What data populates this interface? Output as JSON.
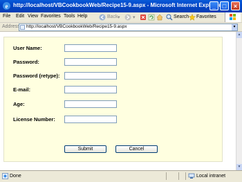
{
  "window": {
    "title": "http://localhost/VBCookbookWeb/Recipe15-9.aspx - Microsoft Internet Explorer"
  },
  "menu": {
    "items": [
      "File",
      "Edit",
      "View",
      "Favorites",
      "Tools",
      "Help"
    ]
  },
  "toolbar": {
    "back_label": "Back",
    "search_label": "Search",
    "favorites_label": "Favorites"
  },
  "address": {
    "label": "Address",
    "url": "http://localhost/VBCookbookWeb/Recipe15-9.aspx"
  },
  "form": {
    "fields": [
      {
        "label": "User Name:",
        "value": ""
      },
      {
        "label": "Password:",
        "value": ""
      },
      {
        "label": "Password (retype):",
        "value": ""
      },
      {
        "label": "E-mail:",
        "value": ""
      },
      {
        "label": "Age:",
        "value": ""
      },
      {
        "label": "License Number:",
        "value": ""
      }
    ],
    "submit_label": "Submit",
    "cancel_label": "Cancel"
  },
  "status": {
    "left": "Done",
    "zone": "Local intranet"
  },
  "colors": {
    "panel_background": "#ffffe0",
    "titlebar": "#0046c8"
  }
}
